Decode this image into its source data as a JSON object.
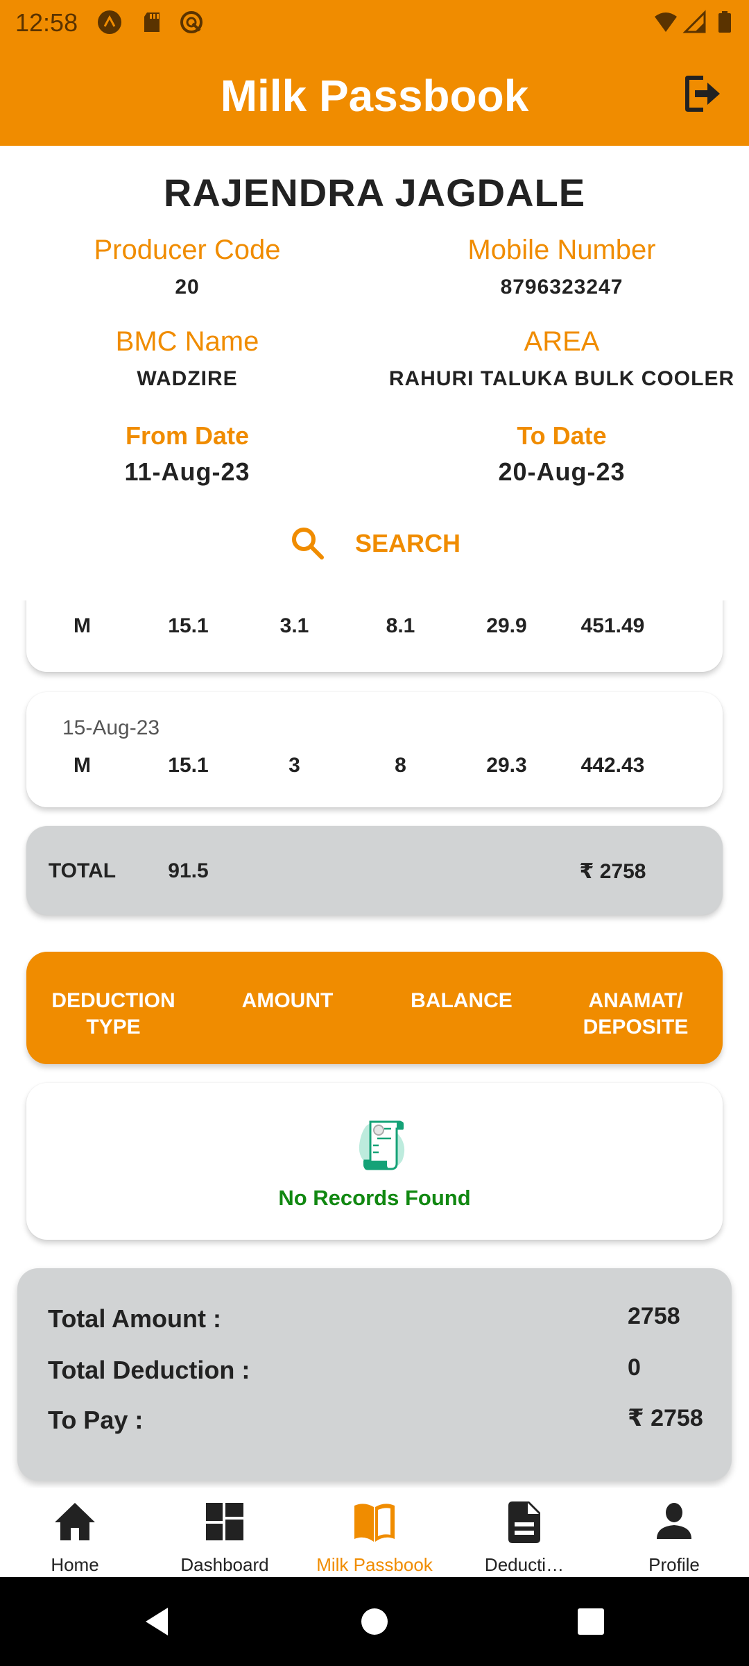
{
  "status_bar": {
    "time": "12:58",
    "icons": [
      "app-notification-icon",
      "sd-card-icon",
      "vpn-icon",
      "wifi-icon",
      "signal-icon",
      "battery-icon"
    ]
  },
  "app_bar": {
    "title": "Milk Passbook",
    "logout_icon": "logout-icon"
  },
  "producer": {
    "name": "RAJENDRA JAGDALE",
    "producer_code_label": "Producer Code",
    "producer_code": "20",
    "mobile_label": "Mobile Number",
    "mobile": "8796323247",
    "bmc_label": "BMC Name",
    "bmc": "WADZIRE",
    "area_label": "AREA",
    "area": "RAHURI TALUKA BULK COOLER",
    "from_label": "From Date",
    "from_date": "11-Aug-23",
    "to_label": "To Date",
    "to_date": "20-Aug-23"
  },
  "search": {
    "label": "SEARCH",
    "icon": "search-icon"
  },
  "collections": [
    {
      "date": "",
      "shift": "M",
      "qty": "15.1",
      "fat": "3.1",
      "snf": "8.1",
      "rate": "29.9",
      "amount": "451.49"
    },
    {
      "date": "15-Aug-23",
      "shift": "M",
      "qty": "15.1",
      "fat": "3",
      "snf": "8",
      "rate": "29.3",
      "amount": "442.43"
    }
  ],
  "total": {
    "label": "TOTAL",
    "qty": "91.5",
    "amount": "₹ 2758"
  },
  "deductions": {
    "headers": [
      "DEDUCTION\nTYPE",
      "AMOUNT",
      "BALANCE",
      "ANAMAT/\nDEPOSITE"
    ],
    "empty_message": "No Records Found",
    "empty_icon": "document-scroll-icon"
  },
  "summary": {
    "total_amount_label": "Total Amount :",
    "total_amount": "2758",
    "total_deduction_label": "Total Deduction :",
    "total_deduction": "0",
    "to_pay_label": "To Pay :",
    "to_pay": "₹ 2758"
  },
  "bottom_nav": {
    "active": "Milk Passbook",
    "items": [
      {
        "label": "Home",
        "icon": "home-icon"
      },
      {
        "label": "Dashboard",
        "icon": "dashboard-icon"
      },
      {
        "label": "Milk Passbook",
        "icon": "book-icon"
      },
      {
        "label": "Deducti…",
        "icon": "document-icon"
      },
      {
        "label": "Profile",
        "icon": "person-icon"
      }
    ]
  },
  "colors": {
    "accent": "#F08C00",
    "success_text": "#118811",
    "summary_bg": "#D1D3D4",
    "text": "#222222"
  }
}
